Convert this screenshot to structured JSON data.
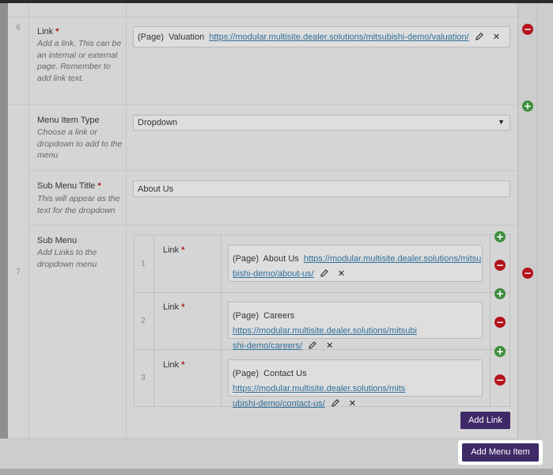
{
  "rows": [
    {
      "number": "6",
      "fields": {
        "link": {
          "label": "Link",
          "required_mark": "*",
          "description": "Add a link. This can be an internal or external page. Remember to add link text.",
          "page_type": "(Page)",
          "page_name": "Valuation",
          "url": "https://modular.multisite.dealer.solutions/mitsubishi-demo/valuation/"
        }
      }
    },
    {
      "number": "7",
      "fields": {
        "menu_item_type": {
          "label": "Menu Item Type",
          "description": "Choose a link or dropdown to add to the menu",
          "value": "Dropdown"
        },
        "sub_menu_title": {
          "label": "Sub Menu Title",
          "required_mark": "*",
          "description": "This will appear as the text for the dropdown",
          "value": "About Us"
        },
        "sub_menu": {
          "label": "Sub Menu",
          "description": "Add Links to the dropdown menu",
          "items": [
            {
              "number": "1",
              "label": "Link",
              "required_mark": "*",
              "page_type": "(Page)",
              "page_name": "About Us",
              "url_line1": "https://modular.multisite.dealer.solutions/mitsu",
              "url_line2": "bishi-demo/about-us/"
            },
            {
              "number": "2",
              "label": "Link",
              "required_mark": "*",
              "page_type": "(Page)",
              "page_name": "Careers",
              "url_line1": "https://modular.multisite.dealer.solutions/mitsubi",
              "url_line2": "shi-demo/careers/"
            },
            {
              "number": "3",
              "label": "Link",
              "required_mark": "*",
              "page_type": "(Page)",
              "page_name": "Contact Us",
              "url_line1": "https://modular.multisite.dealer.solutions/mits",
              "url_line2": "ubishi-demo/contact-us/"
            }
          ],
          "add_link_label": "Add Link"
        }
      }
    }
  ],
  "add_menu_item_label": "Add Menu Item",
  "colors": {
    "primary_button": "#3f2a68",
    "remove": "#b3131b",
    "add": "#3e8e3e",
    "link": "#2f6f9a",
    "required": "#b01818"
  },
  "icons": [
    "pencil-icon",
    "remove-x-icon",
    "plus-icon",
    "minus-icon",
    "dropdown-arrow-icon"
  ]
}
